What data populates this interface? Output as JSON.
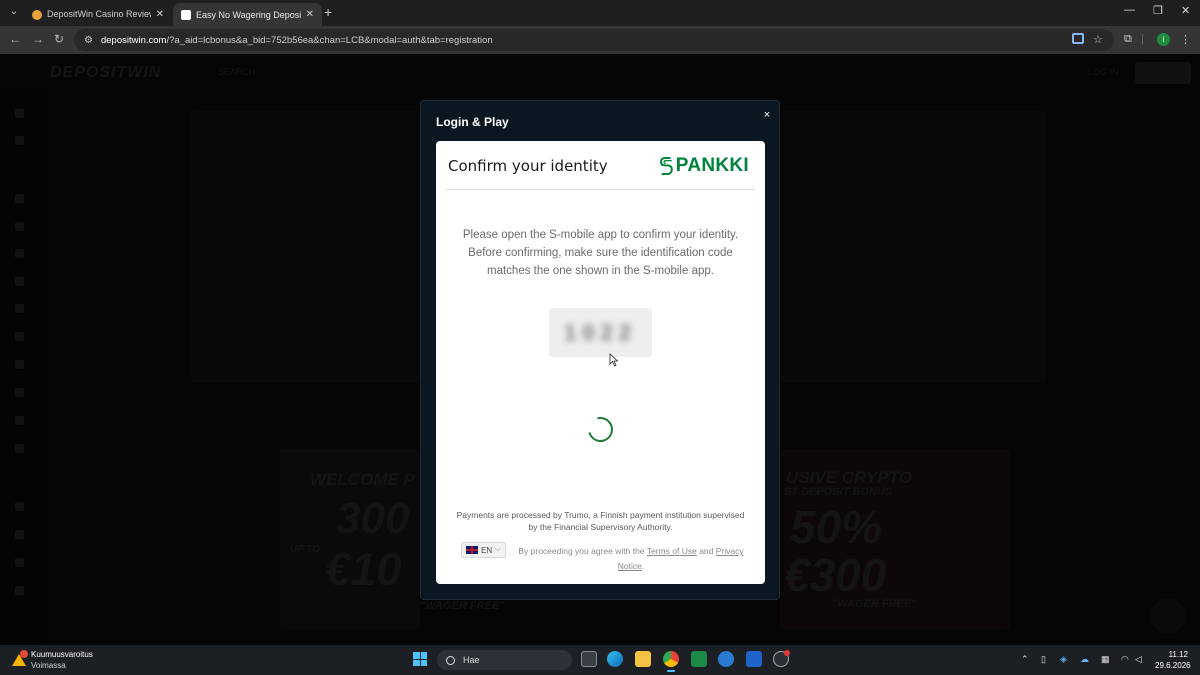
{
  "browser": {
    "tabs": [
      {
        "title": "DepositWin Casino Review ▶ E",
        "active": false
      },
      {
        "title": "Easy No Wagering Deposit Cryp",
        "active": true
      }
    ],
    "url_domain": "depositwin.com",
    "url_rest": "/?a_aid=lcbonus&a_bid=752b56ea&chan=LCB&modal=auth&tab=registration",
    "profile_initial": "i"
  },
  "site": {
    "logo": "DEPOSITWIN",
    "search_label": "SEARCH",
    "login_label": "LOG IN",
    "promo_left": {
      "line1": "WELCOME P",
      "big1": "300",
      "up_to": "UP TO",
      "big2": "€10",
      "wager": "\"WAGER FREE\""
    },
    "promo_right": {
      "line1": "USIVE CRYPTO",
      "line2": "ST DEPOSIT BONUS",
      "big1": "50%",
      "big2": "€300",
      "wager": "\"WAGER FREE\""
    }
  },
  "modal": {
    "title": "Login & Play",
    "close": "×",
    "card": {
      "heading": "Confirm your identity",
      "brand": "PANKKI",
      "message": "Please open the S-mobile app to confirm your identity. Before confirming, make sure the identification code matches the one shown in the S-mobile app.",
      "code": "1022",
      "footer_note": "Payments are processed by Trumo, a Finnish payment institution supervised by the Financial Supervisory Authority.",
      "language": "EN",
      "agree_prefix": "By proceeding you agree with the",
      "terms_link": "Terms of Use",
      "and": "and",
      "privacy_link": "Privacy Notice",
      "agree_suffix": "."
    }
  },
  "taskbar": {
    "weather_title": "Kuumuusvaroitus",
    "weather_sub": "Voimassa",
    "search_placeholder": "Hae",
    "time": "11.12",
    "date": "29.6.2026"
  },
  "colors": {
    "modal_bg": "#0b1720",
    "pankki_green": "#00843d",
    "spinner_green": "#1f7a3a"
  }
}
